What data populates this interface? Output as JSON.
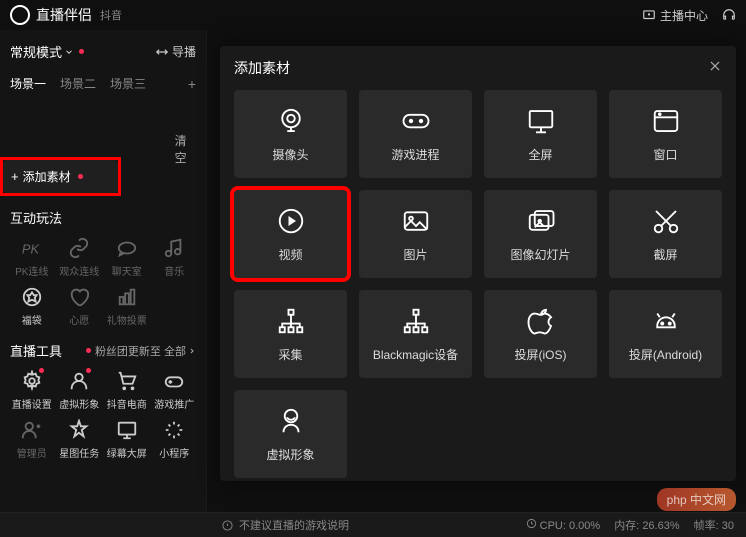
{
  "titlebar": {
    "app_name": "直播伴侣",
    "app_sub": "抖音",
    "host_center": "主播中心"
  },
  "sidebar": {
    "mode_label": "常规模式",
    "import_label": "导播",
    "scenes": [
      "场景一",
      "场景二",
      "场景三"
    ],
    "add_source_label": "添加素材",
    "clear_label": "清空",
    "interaction_title": "互动玩法",
    "interaction_items": [
      {
        "icon": "pk",
        "label": "PK连线"
      },
      {
        "icon": "users",
        "label": "观众连线"
      },
      {
        "icon": "chat",
        "label": "聊天室"
      },
      {
        "icon": "music",
        "label": "音乐"
      },
      {
        "icon": "badge",
        "label": "福袋"
      },
      {
        "icon": "heart",
        "label": "心愿"
      },
      {
        "icon": "bars",
        "label": "礼物投票"
      }
    ],
    "live_tools_title": "直播工具",
    "fans_update": "粉丝团更新至 全部",
    "live_tools_items": [
      {
        "icon": "gear",
        "label": "直播设置",
        "dot": true
      },
      {
        "icon": "avatar",
        "label": "虚拟形象",
        "dot": true
      },
      {
        "icon": "cart",
        "label": "抖音电商"
      },
      {
        "icon": "gamepad",
        "label": "游戏推广"
      },
      {
        "icon": "admin",
        "label": "管理员"
      },
      {
        "icon": "star",
        "label": "星图任务"
      },
      {
        "icon": "greenscreen",
        "label": "绿幕大屏"
      },
      {
        "icon": "miniprogram",
        "label": "小程序"
      }
    ]
  },
  "modal": {
    "title": "添加素材",
    "sources": [
      {
        "icon": "camera",
        "label": "摄像头"
      },
      {
        "icon": "gamepad-round",
        "label": "游戏进程"
      },
      {
        "icon": "monitor",
        "label": "全屏"
      },
      {
        "icon": "window",
        "label": "窗口"
      },
      {
        "icon": "play",
        "label": "视频",
        "highlight": true
      },
      {
        "icon": "image",
        "label": "图片"
      },
      {
        "icon": "slideshow",
        "label": "图像幻灯片"
      },
      {
        "icon": "scissors",
        "label": "截屏"
      },
      {
        "icon": "tree",
        "label": "采集"
      },
      {
        "icon": "tree",
        "label": "Blackmagic设备"
      },
      {
        "icon": "apple",
        "label": "投屏(iOS)"
      },
      {
        "icon": "android",
        "label": "投屏(Android)"
      },
      {
        "icon": "virtual",
        "label": "虚拟形象"
      }
    ]
  },
  "bottombar": {
    "warning": "不建议直播的游戏说明",
    "cpu_label": "CPU:",
    "cpu_value": "0.00%",
    "mem_label": "内存:",
    "mem_value": "26.63%",
    "fps_label": "帧率:",
    "fps_value": "30"
  },
  "watermark": "php 中文网"
}
